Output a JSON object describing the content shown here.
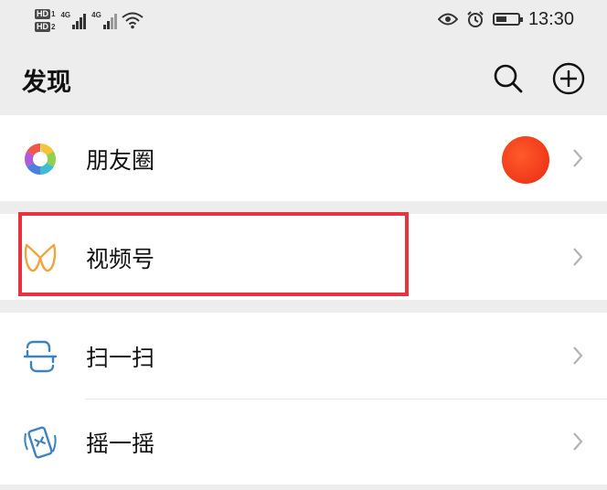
{
  "status_bar": {
    "sim1_label": "HD",
    "sim1_slot": "1",
    "sim2_label": "HD",
    "sim2_slot": "2",
    "network1": "4G",
    "network2": "4G",
    "time": "13:30",
    "battery_level": 0.5
  },
  "header": {
    "title": "发现",
    "search_icon": "search-icon",
    "add_icon": "plus-circle-icon"
  },
  "list": {
    "moments": {
      "label": "朋友圈",
      "icon": "moments-aperture-icon"
    },
    "channels": {
      "label": "视频号",
      "icon": "channels-butterfly-icon"
    },
    "scan": {
      "label": "扫一扫",
      "icon": "scan-icon"
    },
    "shake": {
      "label": "摇一摇",
      "icon": "shake-icon"
    }
  },
  "colors": {
    "background": "#ededed",
    "highlight": "#e8323f",
    "avatar": "#e92a12",
    "channels_icon": "#f0a43c",
    "scan_icon": "#3b82c4",
    "shake_icon": "#3b82c4"
  }
}
